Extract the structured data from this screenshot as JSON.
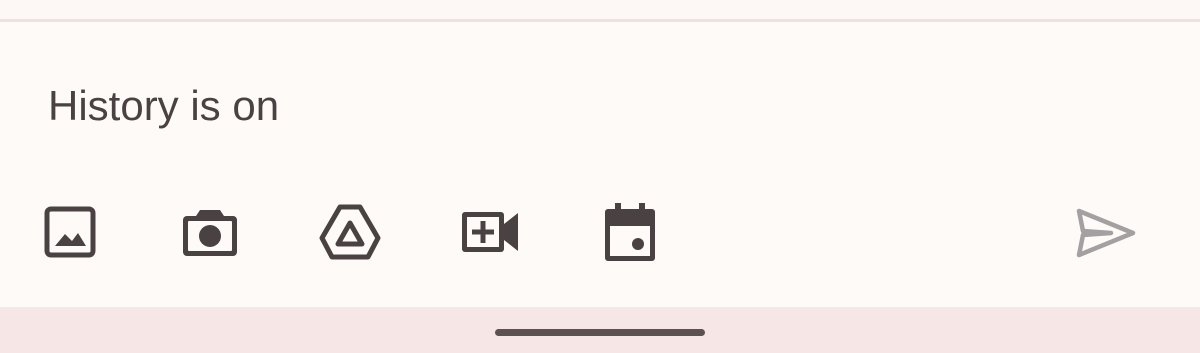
{
  "composer": {
    "input_value": "",
    "input_placeholder": "History is on",
    "icons": {
      "image": "image-icon",
      "camera": "camera-icon",
      "drive": "drive-icon",
      "video_call": "video-call-icon",
      "calendar": "calendar-event-icon",
      "send": "send-icon"
    },
    "send_enabled": false
  },
  "colors": {
    "background": "#fefaf8",
    "text": "#4a4143",
    "icon": "#4a4143",
    "send_disabled": "#a3a0a1",
    "nav_bar": "#f7e6e6",
    "divider": "#efe0e1"
  }
}
